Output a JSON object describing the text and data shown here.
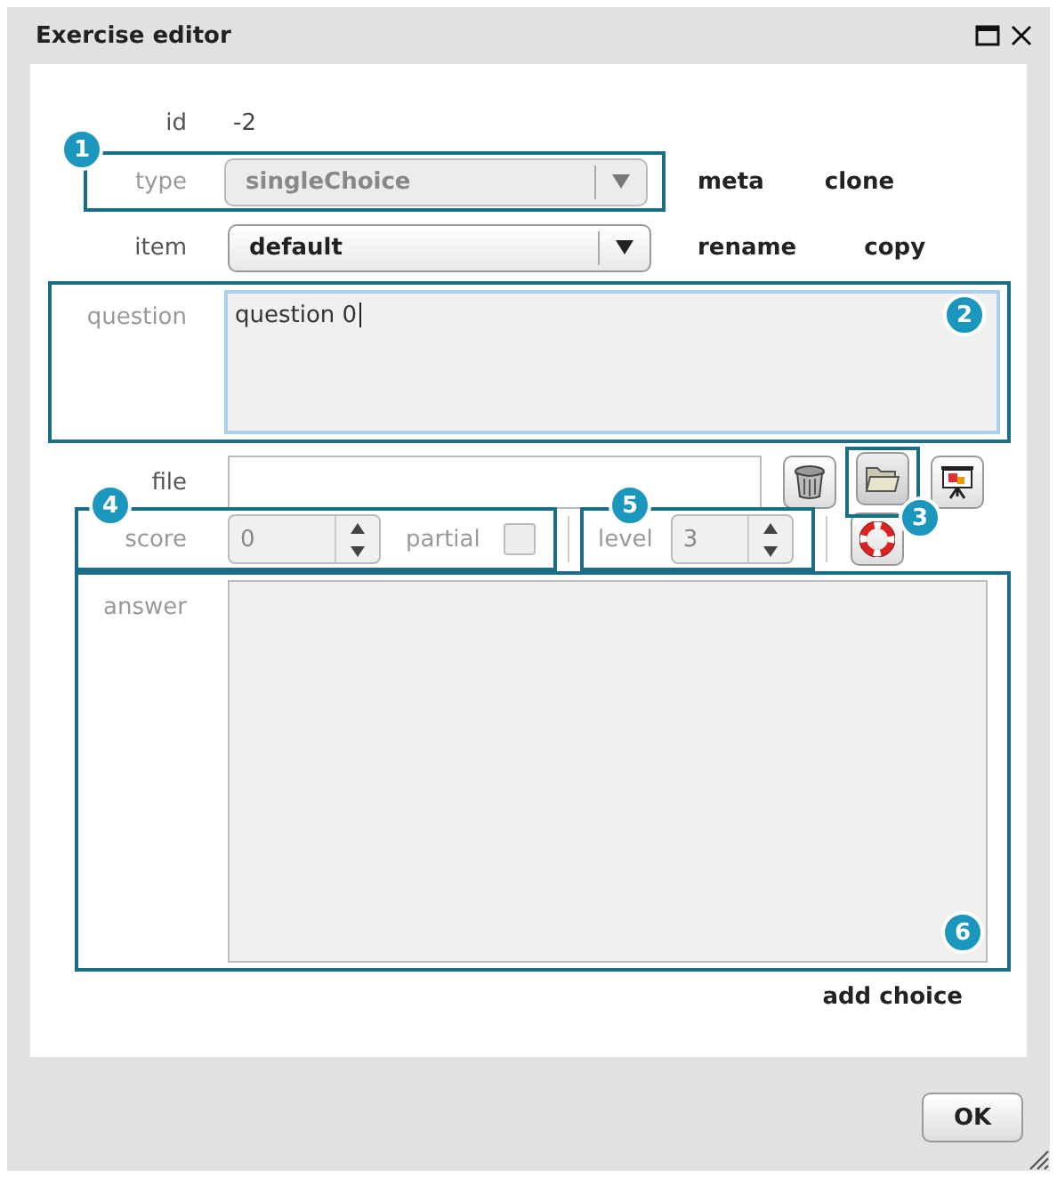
{
  "window": {
    "title": "Exercise editor"
  },
  "id_row": {
    "label": "id",
    "value": "-2"
  },
  "type_row": {
    "callout": "1",
    "label": "type",
    "value": "singleChoice",
    "disabled": true,
    "links": [
      "meta",
      "clone"
    ]
  },
  "item_row": {
    "label": "item",
    "value": "default",
    "disabled": false,
    "links": [
      "rename",
      "copy"
    ]
  },
  "question": {
    "callout": "2",
    "label": "question",
    "value": "question 0",
    "focused": true
  },
  "file": {
    "label": "file",
    "callout": "3"
  },
  "score_group": {
    "callout": "4",
    "score": {
      "label": "score",
      "value": "0",
      "disabled": true
    },
    "partial": {
      "label": "partial",
      "checked": false,
      "disabled": true
    }
  },
  "level_group": {
    "callout": "5",
    "label": "level",
    "value": "3",
    "disabled": true
  },
  "answer": {
    "callout": "6",
    "label": "answer",
    "disabled": true
  },
  "add_choice": "add choice",
  "buttons": [
    "OK"
  ]
}
